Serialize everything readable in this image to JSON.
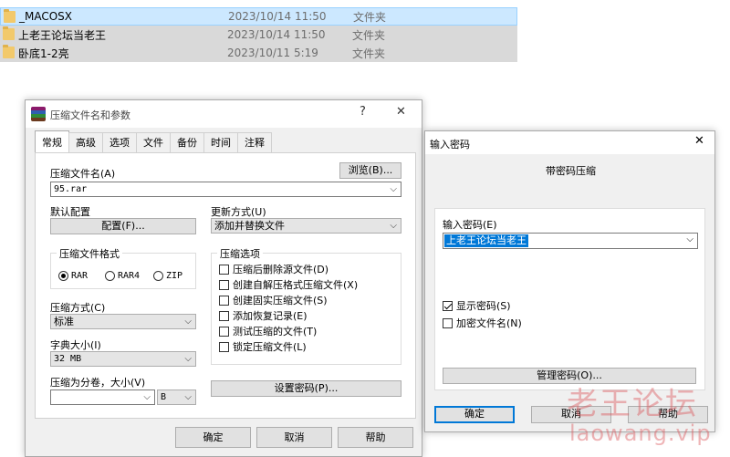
{
  "explorer": {
    "files": [
      {
        "name": "_MACOSX",
        "date": "2023/10/14 11:50",
        "type": "文件夹"
      },
      {
        "name": "上老王论坛当老王",
        "date": "2023/10/14 11:50",
        "type": "文件夹"
      },
      {
        "name": "卧底1-2亮",
        "date": "2023/10/11 5:19",
        "type": "文件夹"
      }
    ]
  },
  "main_dialog": {
    "title": "压缩文件名和参数",
    "help_btn": "?",
    "close_btn": "✕",
    "tabs": [
      "常规",
      "高级",
      "选项",
      "文件",
      "备份",
      "时间",
      "注释"
    ],
    "archive_name_label": "压缩文件名(A)",
    "browse_label": "浏览(B)...",
    "archive_name_value": "95.rar",
    "default_profile_label": "默认配置",
    "profile_button": "配置(F)...",
    "update_mode_label": "更新方式(U)",
    "update_mode_value": "添加并替换文件",
    "format_group_title": "压缩文件格式",
    "formats": [
      "RAR",
      "RAR4",
      "ZIP"
    ],
    "selected_format": "RAR",
    "method_label": "压缩方式(C)",
    "method_value": "标准",
    "dict_label": "字典大小(I)",
    "dict_value": "32 MB",
    "volume_label": "压缩为分卷，大小(V)",
    "volume_value": "",
    "volume_unit": "B",
    "options_group_title": "压缩选项",
    "options": [
      {
        "label": "压缩后删除源文件(D)",
        "checked": false
      },
      {
        "label": "创建自解压格式压缩文件(X)",
        "checked": false
      },
      {
        "label": "创建固实压缩文件(S)",
        "checked": false
      },
      {
        "label": "添加恢复记录(E)",
        "checked": false
      },
      {
        "label": "测试压缩的文件(T)",
        "checked": false
      },
      {
        "label": "锁定压缩文件(L)",
        "checked": false
      }
    ],
    "set_password_button": "设置密码(P)...",
    "ok_button": "确定",
    "cancel_button": "取消",
    "help_button": "帮助"
  },
  "password_dialog": {
    "title": "输入密码",
    "close_btn": "✕",
    "heading": "带密码压缩",
    "enter_password_label": "输入密码(E)",
    "password_value": "上老王论坛当老王",
    "show_password_label": "显示密码(S)",
    "show_password_checked": true,
    "encrypt_names_label": "加密文件名(N)",
    "encrypt_names_checked": false,
    "organize_button": "管理密码(O)...",
    "ok_button": "确定",
    "cancel_button": "取消",
    "help_button": "帮助"
  },
  "watermark": {
    "main": "老王论坛",
    "sub": "laowang.vip"
  }
}
